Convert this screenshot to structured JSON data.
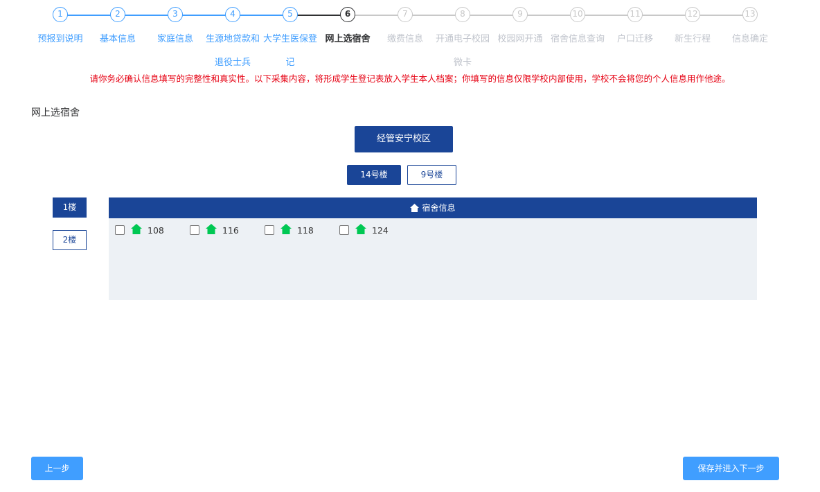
{
  "steps": [
    {
      "num": "1",
      "label": "预报到说明",
      "state": "done"
    },
    {
      "num": "2",
      "label": "基本信息",
      "state": "done"
    },
    {
      "num": "3",
      "label": "家庭信息",
      "state": "done"
    },
    {
      "num": "4",
      "label": "生源地贷款和退役士兵",
      "state": "done"
    },
    {
      "num": "5",
      "label": "大学生医保登记",
      "state": "done"
    },
    {
      "num": "6",
      "label": "网上选宿舍",
      "state": "active"
    },
    {
      "num": "7",
      "label": "缴费信息",
      "state": "pending"
    },
    {
      "num": "8",
      "label": "开通电子校园微卡",
      "state": "pending"
    },
    {
      "num": "9",
      "label": "校园网开通",
      "state": "pending"
    },
    {
      "num": "10",
      "label": "宿舍信息查询",
      "state": "pending"
    },
    {
      "num": "11",
      "label": "户口迁移",
      "state": "pending"
    },
    {
      "num": "12",
      "label": "新生行程",
      "state": "pending"
    },
    {
      "num": "13",
      "label": "信息确定",
      "state": "pending"
    }
  ],
  "notice": "请你务必确认信息填写的完整性和真实性。以下采集内容，将形成学生登记表放入学生本人档案；你填写的信息仅限学校内部使用，学校不会将您的个人信息用作他途。",
  "section_title": "网上选宿舍",
  "campus": "经管安宁校区",
  "buildings": [
    {
      "label": "14号楼",
      "selected": true
    },
    {
      "label": "9号楼",
      "selected": false
    }
  ],
  "floors": [
    {
      "label": "1楼",
      "selected": true
    },
    {
      "label": "2楼",
      "selected": false
    }
  ],
  "dorm_header": "宿舍信息",
  "rooms": [
    {
      "number": "108",
      "checked": false,
      "icon": "house-icon"
    },
    {
      "number": "116",
      "checked": false,
      "icon": "house-icon"
    },
    {
      "number": "118",
      "checked": false,
      "icon": "house-icon"
    },
    {
      "number": "124",
      "checked": false,
      "icon": "house-icon"
    }
  ],
  "buttons": {
    "prev": "上一步",
    "next": "保存并进入下一步"
  },
  "colors": {
    "primary": "#1a4597",
    "accent": "#409eff",
    "notice": "#e60012",
    "room_icon": "#00c853"
  }
}
